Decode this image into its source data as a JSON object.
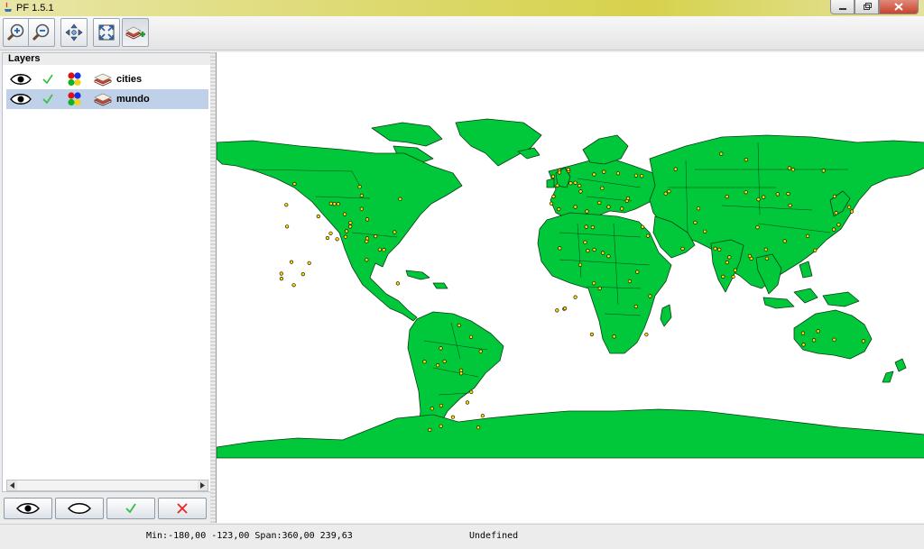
{
  "window": {
    "title": "PF 1.5.1",
    "controls": [
      "minimize",
      "maximize",
      "close"
    ]
  },
  "toolbar": {
    "buttons": [
      {
        "name": "zoom-in-button",
        "icon": "zoom-in-icon"
      },
      {
        "name": "zoom-out-button",
        "icon": "zoom-out-icon"
      },
      {
        "name": "pan-button",
        "icon": "pan-arrows-icon"
      },
      {
        "name": "zoom-extent-button",
        "icon": "full-extent-icon"
      },
      {
        "name": "add-layer-button",
        "icon": "add-layer-icon"
      }
    ]
  },
  "layers_panel": {
    "title": "Layers",
    "layers": [
      {
        "name": "cities",
        "visible": true,
        "enabled": true,
        "selected": false
      },
      {
        "name": "mundo",
        "visible": true,
        "enabled": true,
        "selected": true
      }
    ],
    "buttons": [
      {
        "name": "show-layer-button",
        "icon": "eye-icon"
      },
      {
        "name": "hide-layer-button",
        "icon": "eye-closed-icon"
      },
      {
        "name": "enable-layer-button",
        "icon": "check-icon"
      },
      {
        "name": "remove-layer-button",
        "icon": "red-x-icon"
      }
    ]
  },
  "map": {
    "land_color": "#00c83a",
    "outline_color": "#0a3d12",
    "city_color": "#ffd800"
  },
  "status": {
    "extent": "Min:-180,00 -123,00 Span:360,00 239,63",
    "crs": "Undefined"
  }
}
